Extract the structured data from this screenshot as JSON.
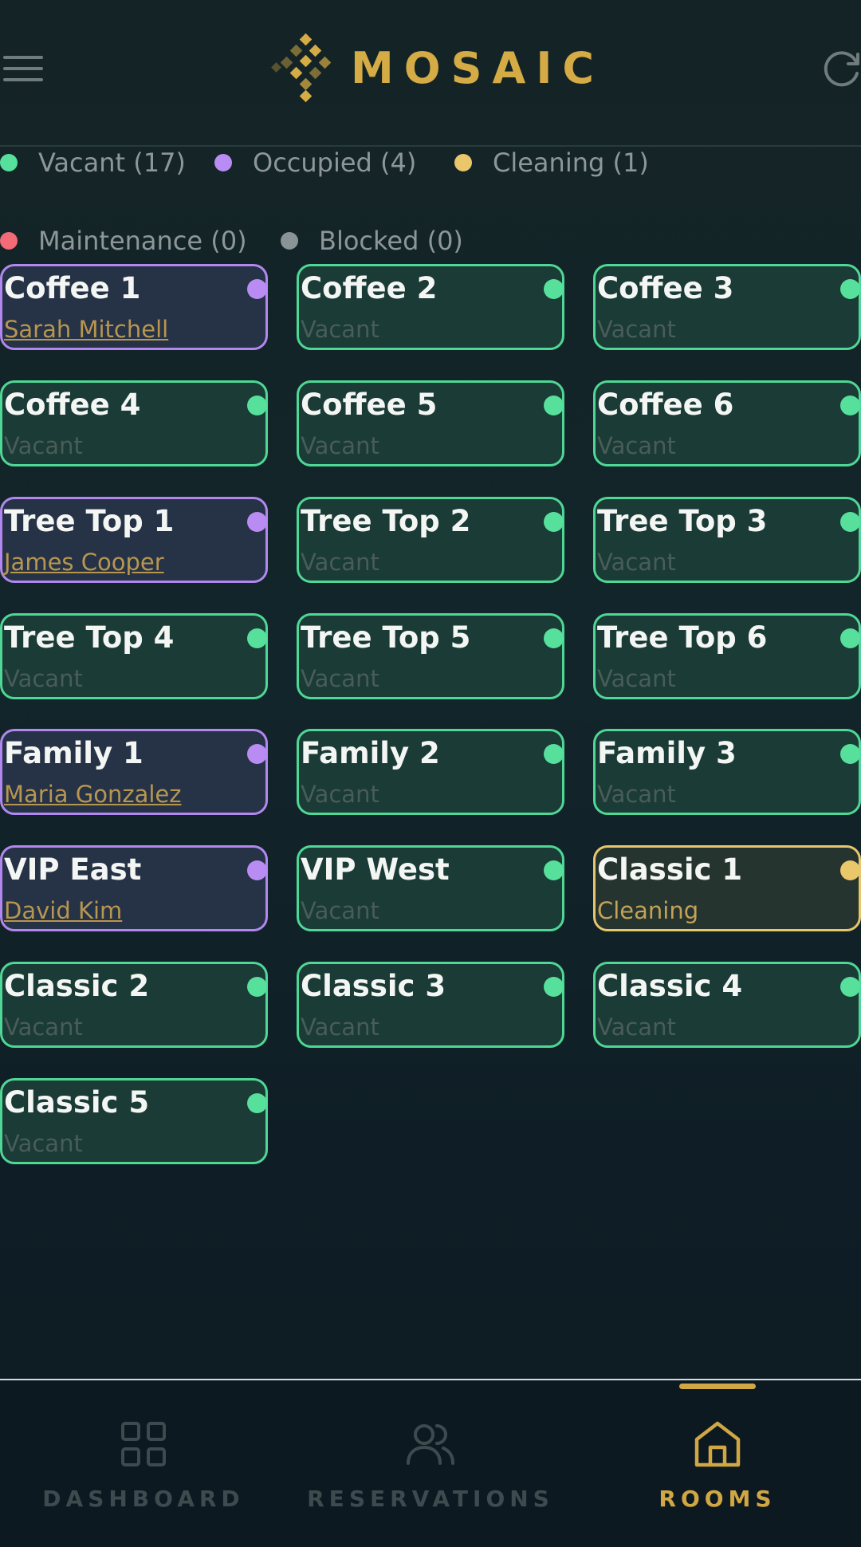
{
  "header": {
    "brand_name": "MOSAIC",
    "menu_icon": "hamburger-menu-icon",
    "refresh_icon": "refresh-icon"
  },
  "colors": {
    "vacant": "#57e09b",
    "occupied": "#b98cf3",
    "cleaning": "#e9c76a",
    "maintenance": "#f26b77",
    "blocked": "#8a9496",
    "brand": "#d4ab45"
  },
  "legend": [
    {
      "label": "Vacant (17)",
      "status": "vacant"
    },
    {
      "label": "Occupied (4)",
      "status": "occupied"
    },
    {
      "label": "Cleaning (1)",
      "status": "cleaning"
    },
    {
      "label": "Maintenance (0)",
      "status": "maintenance"
    },
    {
      "label": "Blocked (0)",
      "status": "blocked"
    }
  ],
  "rooms": [
    {
      "name": "Coffee 1",
      "status": "occupied",
      "detail": "Sarah Mitchell"
    },
    {
      "name": "Coffee 2",
      "status": "vacant",
      "detail": "Vacant"
    },
    {
      "name": "Coffee 3",
      "status": "vacant",
      "detail": "Vacant"
    },
    {
      "name": "Coffee 4",
      "status": "vacant",
      "detail": "Vacant"
    },
    {
      "name": "Coffee 5",
      "status": "vacant",
      "detail": "Vacant"
    },
    {
      "name": "Coffee 6",
      "status": "vacant",
      "detail": "Vacant"
    },
    {
      "name": "Tree Top 1",
      "status": "occupied",
      "detail": "James Cooper"
    },
    {
      "name": "Tree Top 2",
      "status": "vacant",
      "detail": "Vacant"
    },
    {
      "name": "Tree Top 3",
      "status": "vacant",
      "detail": "Vacant"
    },
    {
      "name": "Tree Top 4",
      "status": "vacant",
      "detail": "Vacant"
    },
    {
      "name": "Tree Top 5",
      "status": "vacant",
      "detail": "Vacant"
    },
    {
      "name": "Tree Top 6",
      "status": "vacant",
      "detail": "Vacant"
    },
    {
      "name": "Family 1",
      "status": "occupied",
      "detail": "Maria Gonzalez"
    },
    {
      "name": "Family 2",
      "status": "vacant",
      "detail": "Vacant"
    },
    {
      "name": "Family 3",
      "status": "vacant",
      "detail": "Vacant"
    },
    {
      "name": "VIP East",
      "status": "occupied",
      "detail": "David Kim"
    },
    {
      "name": "VIP West",
      "status": "vacant",
      "detail": "Vacant"
    },
    {
      "name": "Classic 1",
      "status": "cleaning",
      "detail": "Cleaning"
    },
    {
      "name": "Classic 2",
      "status": "vacant",
      "detail": "Vacant"
    },
    {
      "name": "Classic 3",
      "status": "vacant",
      "detail": "Vacant"
    },
    {
      "name": "Classic 4",
      "status": "vacant",
      "detail": "Vacant"
    },
    {
      "name": "Classic 5",
      "status": "vacant",
      "detail": "Vacant"
    }
  ],
  "nav": {
    "tabs": [
      {
        "label": "DASHBOARD",
        "icon": "dashboard-grid-icon",
        "active": false
      },
      {
        "label": "RESERVATIONS",
        "icon": "users-icon",
        "active": false
      },
      {
        "label": "ROOMS",
        "icon": "home-icon",
        "active": true
      }
    ]
  }
}
